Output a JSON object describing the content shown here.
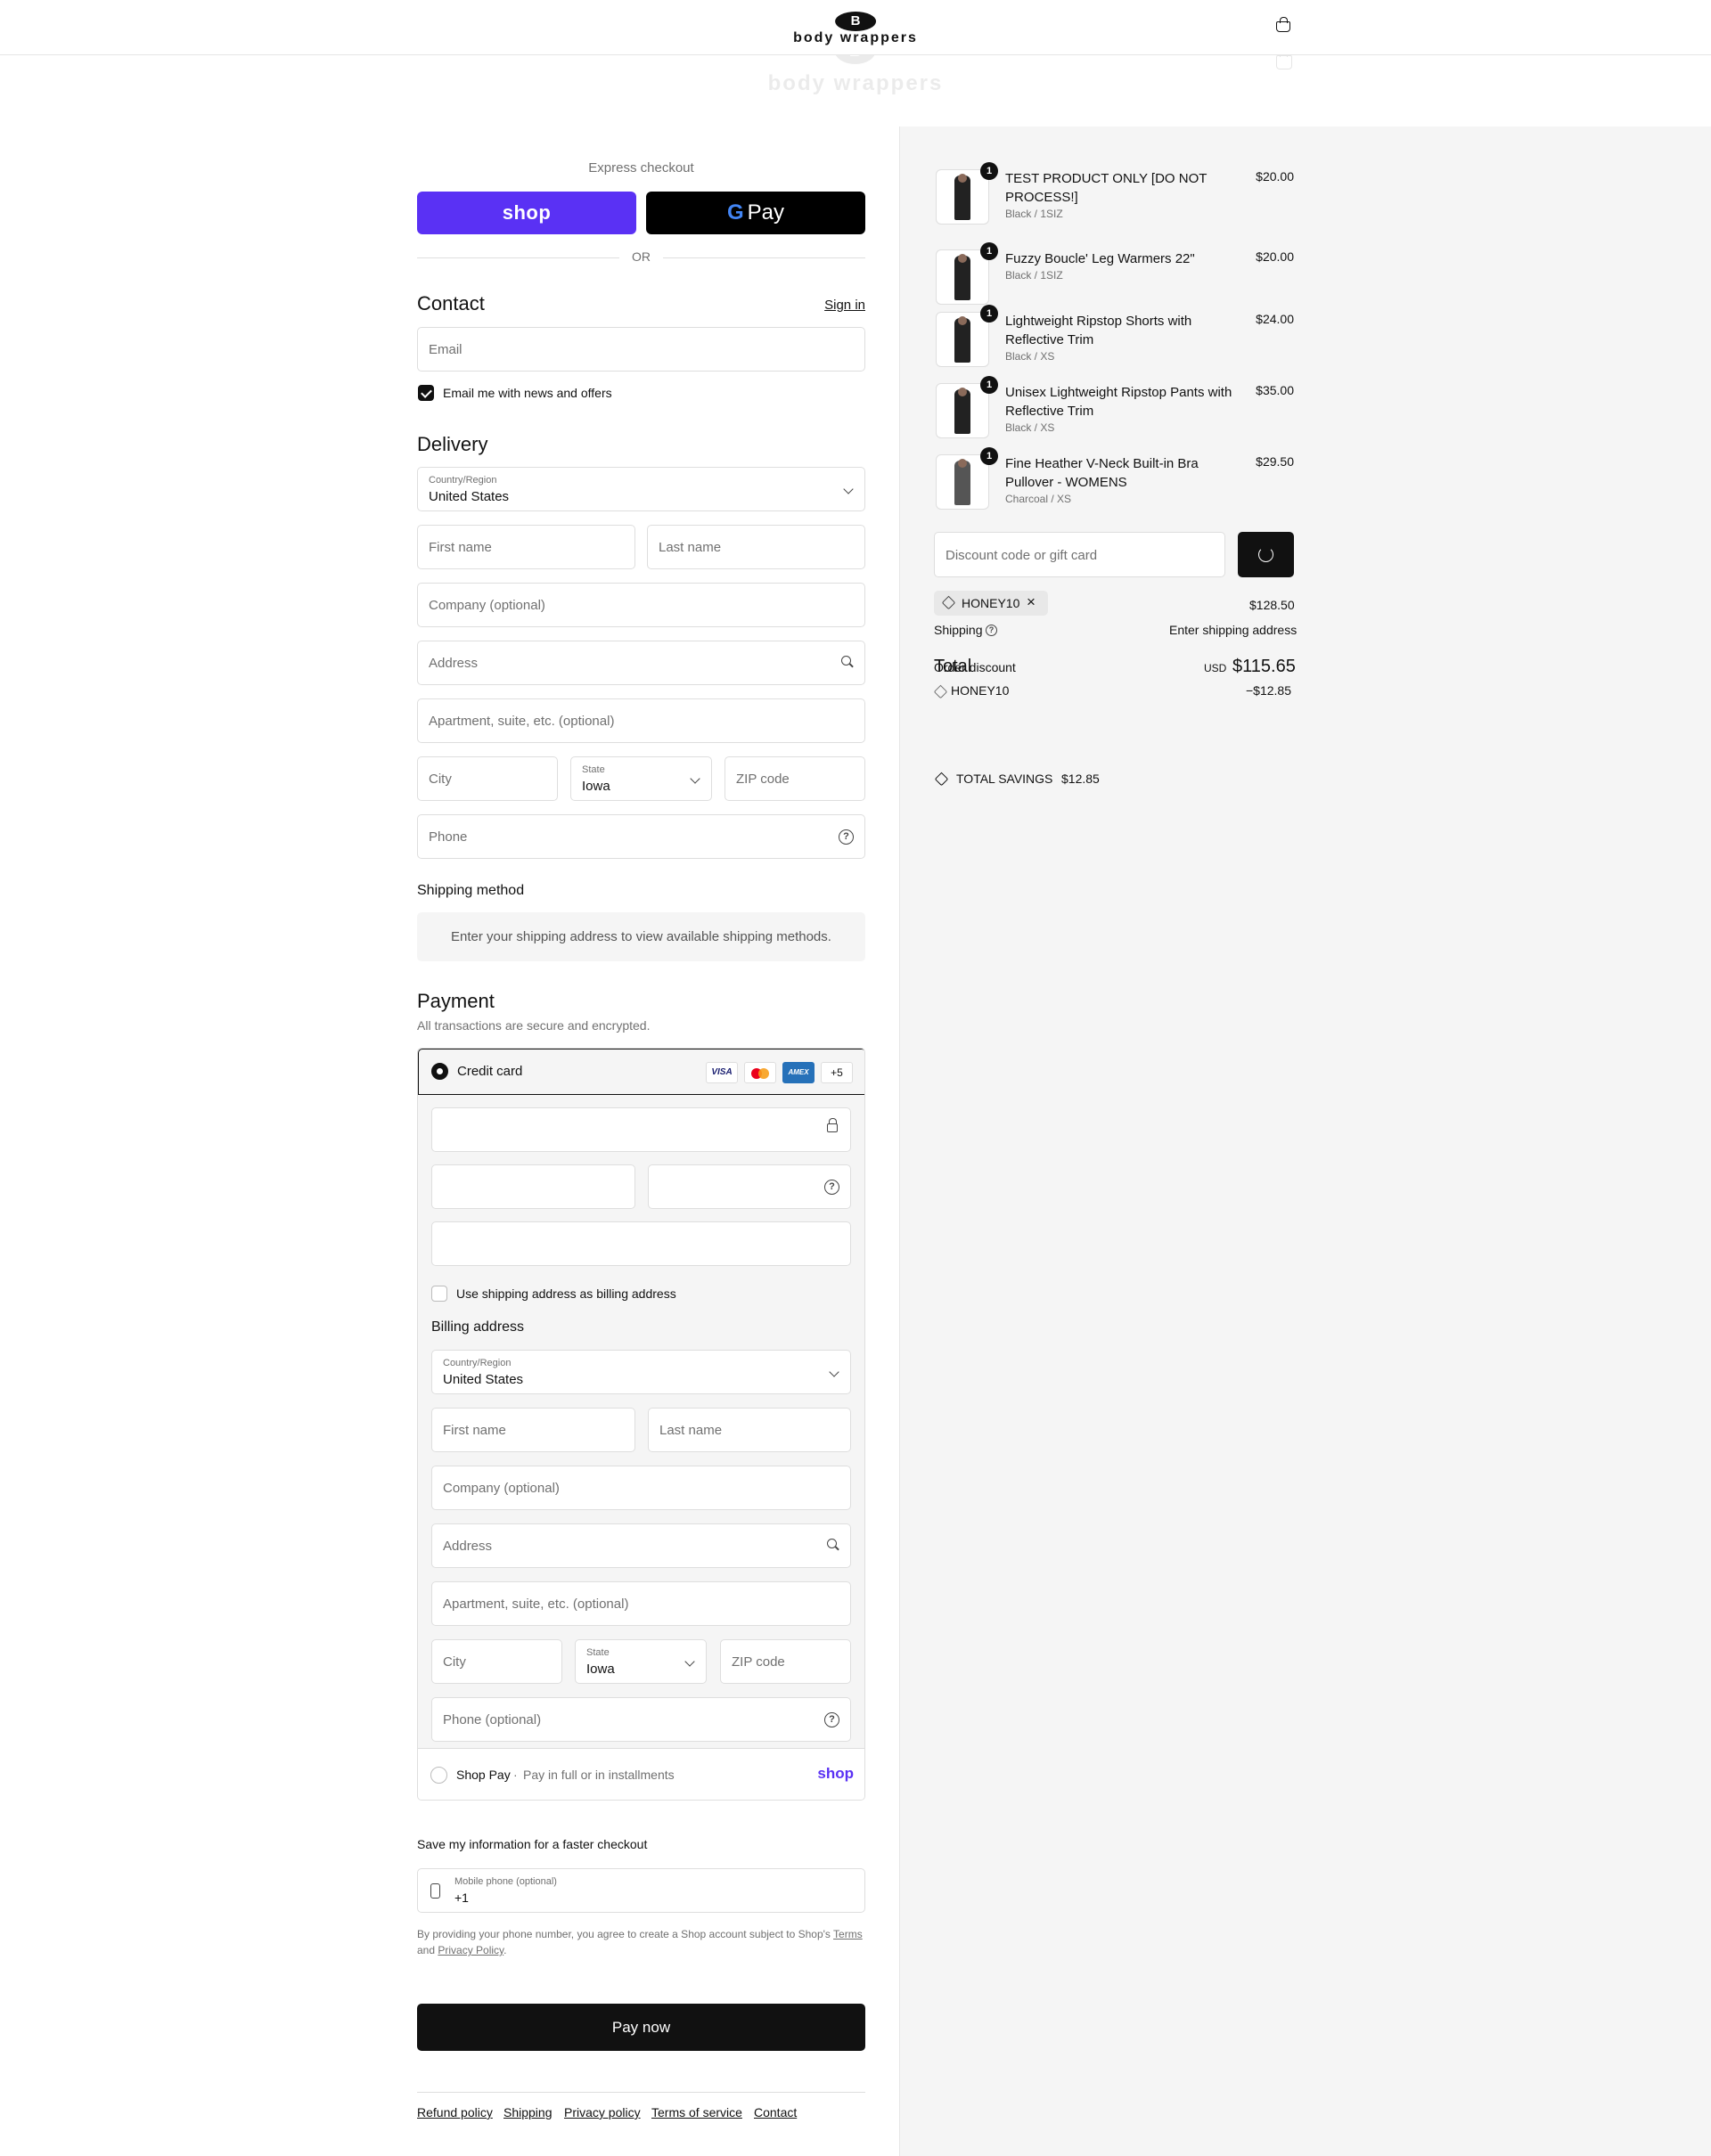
{
  "brand": {
    "mark": "B",
    "name": "body wrappers"
  },
  "express": {
    "label": "Express checkout",
    "shop_label": "shop",
    "gpay_g": "G",
    "gpay_label": "Pay",
    "or": "OR"
  },
  "contact": {
    "title": "Contact",
    "sign_in": "Sign in",
    "email_placeholder": "Email",
    "newsletter": "Email me with news and offers",
    "newsletter_checked": true
  },
  "delivery": {
    "title": "Delivery",
    "country_label": "Country/Region",
    "country": "United States",
    "first_name": "First name",
    "last_name": "Last name",
    "company": "Company (optional)",
    "address": "Address",
    "apartment": "Apartment, suite, etc. (optional)",
    "city": "City",
    "state_label": "State",
    "state": "Iowa",
    "zip": "ZIP code",
    "phone": "Phone"
  },
  "shipping_method": {
    "title": "Shipping method",
    "note": "Enter your shipping address to view available shipping methods."
  },
  "payment": {
    "title": "Payment",
    "subtitle": "All transactions are secure and encrypted.",
    "credit_card": "Credit card",
    "cards": [
      "VISA",
      "AMEX",
      "+5"
    ],
    "use_shipping": "Use shipping address as billing address",
    "billing_title": "Billing address",
    "billing": {
      "country_label": "Country/Region",
      "country": "United States",
      "first_name": "First name",
      "last_name": "Last name",
      "company": "Company (optional)",
      "address": "Address",
      "apartment": "Apartment, suite, etc. (optional)",
      "city": "City",
      "state_label": "State",
      "state": "Iowa",
      "zip": "ZIP code",
      "phone": "Phone (optional)"
    },
    "shop_pay": "Shop Pay",
    "shop_pay_sep": "·",
    "shop_pay_desc": "Pay in full or in installments",
    "shop_pay_logo": "shop"
  },
  "save_info": {
    "title": "Save my information for a faster checkout",
    "phone_label": "Mobile phone (optional)",
    "phone_value": "+1",
    "fine_pre": "By providing your phone number, you agree to create a Shop account subject to Shop's",
    "terms": "Terms",
    "and": "and",
    "privacy": "Privacy Policy",
    "period": "."
  },
  "pay_now": "Pay now",
  "footer": [
    "Refund policy",
    "Shipping",
    "Privacy policy",
    "Terms of service",
    "Contact"
  ],
  "cart": [
    {
      "qty": "1",
      "name": "TEST PRODUCT ONLY [DO NOT PROCESS!]",
      "variant": "Black / 1SIZ",
      "price": "$20.00"
    },
    {
      "qty": "1",
      "name": "Fuzzy Boucle' Leg Warmers 22\"",
      "variant": "Black / 1SIZ",
      "price": "$20.00"
    },
    {
      "qty": "1",
      "name": "Lightweight Ripstop Shorts with Reflective Trim",
      "variant": "Black / XS",
      "price": "$24.00"
    },
    {
      "qty": "1",
      "name": "Unisex Lightweight Ripstop Pants with Reflective Trim",
      "variant": "Black / XS",
      "price": "$35.00"
    },
    {
      "qty": "1",
      "name": "Fine Heather V-Neck Built-in Bra Pullover - WOMENS",
      "variant": "Charcoal / XS",
      "price": "$29.50"
    }
  ],
  "discount": {
    "placeholder": "Discount code or gift card",
    "code": "HONEY10"
  },
  "summary": {
    "subtotal": "$128.50",
    "shipping_label": "Shipping",
    "shipping_value": "Enter shipping address",
    "total_label": "Total",
    "order_discount_label": "Order discount",
    "currency": "USD",
    "total": "$115.65",
    "discount_code": "HONEY10",
    "discount_value": "−$12.85",
    "savings_label": "TOTAL SAVINGS",
    "savings_value": "$12.85"
  }
}
